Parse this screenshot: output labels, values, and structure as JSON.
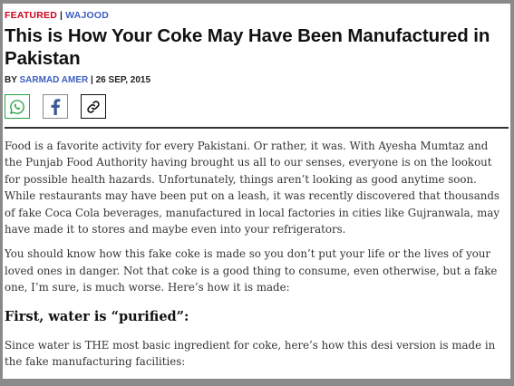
{
  "categories": {
    "primary": "FEATURED",
    "separator": "|",
    "secondary": "WAJOOD"
  },
  "article": {
    "title": "This is How Your Coke May Have Been Manufactured in Pakistan",
    "byline": {
      "by": "BY",
      "author": "SARMAD AMER",
      "separator": "|",
      "date": "26 SEP, 2015"
    },
    "share": [
      {
        "icon": "whatsapp-icon"
      },
      {
        "icon": "facebook-icon"
      },
      {
        "icon": "link-icon"
      }
    ],
    "paragraphs": [
      "Food is a favorite activity for every Pakistani. Or rather, it was. With Ayesha Mumtaz and the Punjab Food Authority having brought us all to our senses, everyone is on the lookout for possible health hazards. Unfortunately, things aren’t looking as good anytime soon. While restaurants may have been put on a leash, it was recently discovered that thousands of fake Coca Cola beverages, manufactured in local factories in cities like Gujranwala, may have made it to stores and maybe even into your refrigerators.",
      "You should know how this fake coke is made so you don’t put your life or the lives of your loved ones in danger. Not that coke is a good thing to consume, even otherwise, but a fake one, I’m sure, is much worse. Here’s how it is made:"
    ],
    "subheading": "First, water is “purified”:",
    "paragraph_after": "Since water is THE most basic ingredient for coke, here’s how this desi version is made in the fake manufacturing facilities:"
  },
  "colors": {
    "featured": "#d0021b",
    "link": "#3b5fc0",
    "whatsapp": "#25a244",
    "facebook": "#3b5998"
  }
}
